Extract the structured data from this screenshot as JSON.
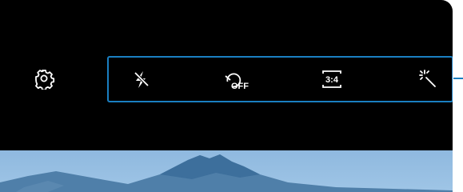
{
  "toolbar": {
    "settings": {
      "icon": "gear-icon"
    },
    "buttons": [
      {
        "name": "flash",
        "icon": "flash-off-icon"
      },
      {
        "name": "timer",
        "icon": "timer-off-icon",
        "label": "OFF"
      },
      {
        "name": "ratio",
        "icon": "aspect-ratio-icon",
        "label": "3:4"
      },
      {
        "name": "effects",
        "icon": "magic-wand-icon"
      }
    ]
  },
  "colors": {
    "screen": "#000000",
    "icons": "#ffffff",
    "callout": "#1a7fc1",
    "preview_sky": "#9cc4e6",
    "preview_mountain": "#3d6f9c"
  }
}
